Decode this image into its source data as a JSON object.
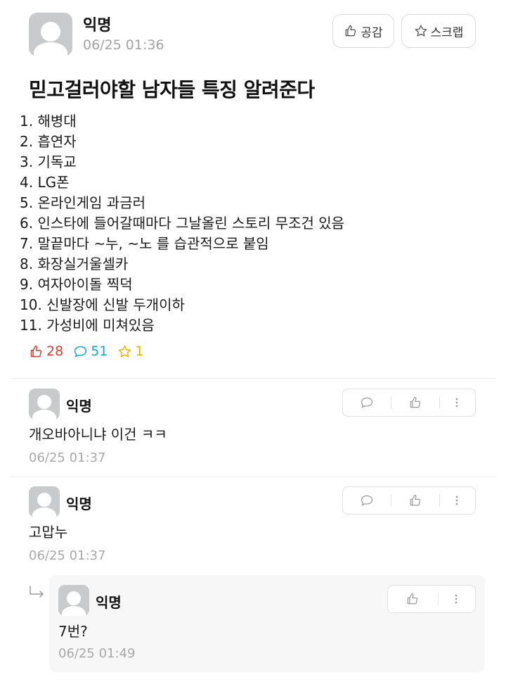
{
  "post": {
    "author": "익명",
    "time": "06/25 01:36",
    "like_button_label": "공감",
    "scrap_button_label": "스크랩",
    "title": "믿고걸러야할 남자들 특징 알려준다",
    "lines": [
      "1. 해병대",
      "2. 흡연자",
      "3. 기독교",
      "4. LG폰",
      "5. 온라인게임 과금러",
      "6. 인스타에 들어갈때마다 그날올린 스토리 무조건 있음",
      "7. 말끝마다 ~누, ~노 를 습관적으로 붙임",
      "8. 화장실거울셀카",
      "9. 여자아이돌 찍덕",
      "10. 신발장에 신발 두개이하",
      "11. 가성비에 미쳐있음"
    ],
    "stats": {
      "likes": "28",
      "comments": "51",
      "scraps": "1"
    }
  },
  "comments": [
    {
      "author": "익명",
      "text": "개오바아니냐 이건 ㅋㅋ",
      "time": "06/25 01:37"
    },
    {
      "author": "익명",
      "text": "고맙누",
      "time": "06/25 01:37"
    }
  ],
  "reply": {
    "author": "익명",
    "text": "7번?",
    "time": "06/25 01:49"
  },
  "colors": {
    "like": "#d33f2f",
    "comment": "#18a5c9",
    "scrap": "#e8b400",
    "muted": "#a3a3a3"
  }
}
